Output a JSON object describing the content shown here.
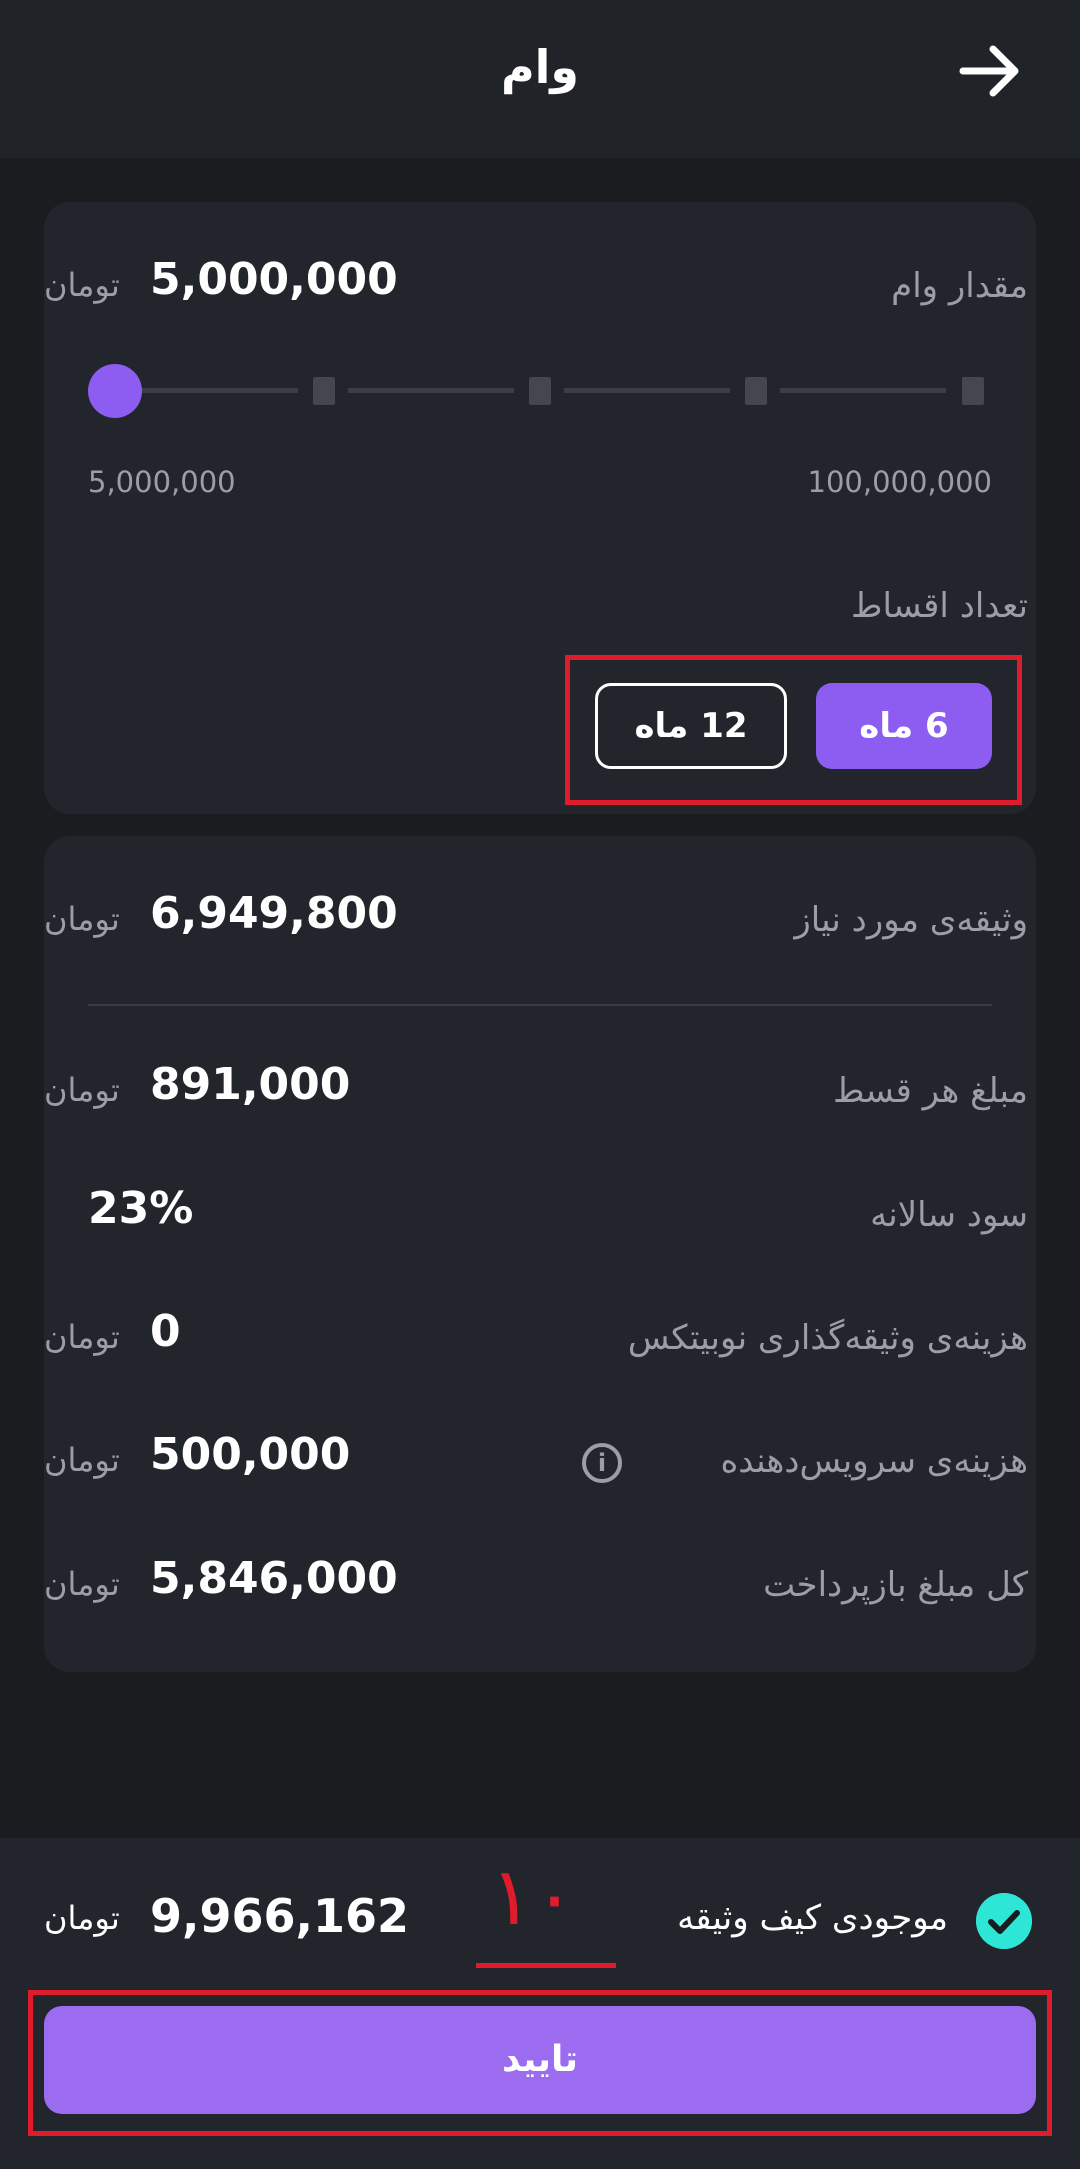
{
  "header": {
    "title": "وام",
    "back_icon": "arrow-right-icon"
  },
  "loan": {
    "label": "مقدار وام",
    "value": "5,000,000",
    "unit": "تومان",
    "slider": {
      "min_label": "5,000,000",
      "max_label": "100,000,000",
      "level_fraction": 0,
      "steps": 5
    }
  },
  "installments": {
    "label": "تعداد اقساط",
    "options": [
      {
        "label": "6 ماه",
        "selected": true
      },
      {
        "label": "12 ماه",
        "selected": false
      }
    ]
  },
  "details": {
    "collateral": {
      "label": "وثیقه‌ی مورد نیاز",
      "value": "6,949,800",
      "unit": "تومان"
    },
    "per_installment": {
      "label": "مبلغ هر قسط",
      "value": "891,000",
      "unit": "تومان"
    },
    "annual_interest": {
      "label": "سود سالانه",
      "value": "23%"
    },
    "nobitex_fee": {
      "label": "هزینه‌ی وثیقه‌گذاری نوبیتکس",
      "value": "0",
      "unit": "تومان"
    },
    "service_fee": {
      "label": "هزینه‌ی سرویس‌دهنده",
      "value": "500,000",
      "unit": "تومان"
    },
    "total_repayment": {
      "label": "کل مبلغ بازپرداخت",
      "value": "5,846,000",
      "unit": "تومان"
    }
  },
  "wallet": {
    "label": "موجودی کیف وثیقه",
    "value": "9,966,162",
    "unit": "تومان",
    "checked": true
  },
  "annotation": {
    "number": "۱۰"
  },
  "confirm": {
    "label": "تایید"
  },
  "colors": {
    "accent": "#8d5cf0",
    "confirm": "#9b6cf0",
    "check": "#2ee6d6",
    "annotation": "#e01b2c"
  }
}
